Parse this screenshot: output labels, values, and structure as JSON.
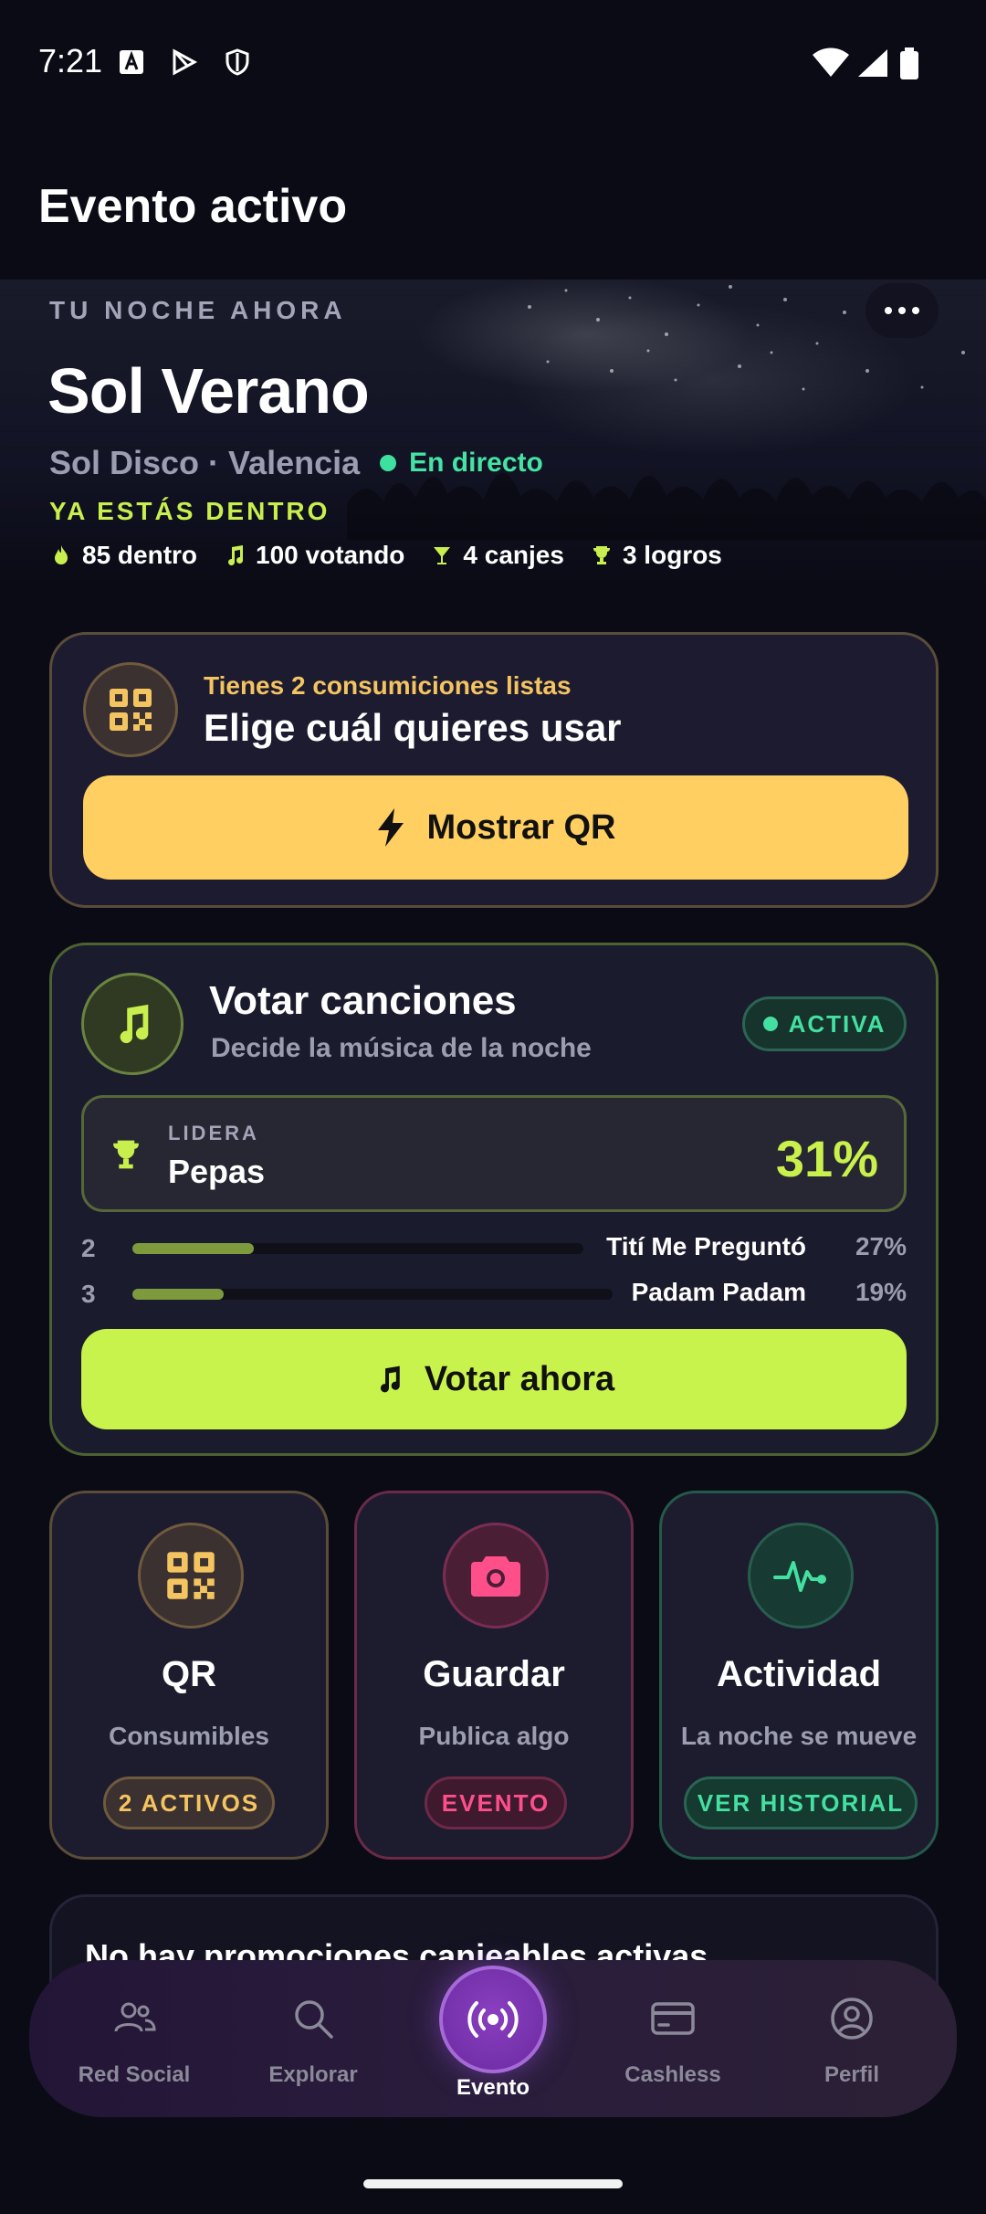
{
  "status_bar": {
    "time": "7:21"
  },
  "page": {
    "title": "Evento activo"
  },
  "hero": {
    "kicker": "TU NOCHE AHORA",
    "title": "Sol Verano",
    "venue": "Sol Disco · Valencia",
    "live": "En directo",
    "inside": "YA ESTÁS DENTRO",
    "stats": [
      {
        "icon": "flame-icon",
        "label": "85 dentro"
      },
      {
        "icon": "music-note-icon",
        "label": "100 votando"
      },
      {
        "icon": "cocktail-icon",
        "label": "4 canjes"
      },
      {
        "icon": "trophy-icon",
        "label": "3 logros"
      }
    ]
  },
  "qr_card": {
    "subtitle": "Tienes 2 consumiciones listas",
    "title": "Elige cuál quieres usar",
    "button": "Mostrar QR"
  },
  "vote_card": {
    "title": "Votar canciones",
    "subtitle": "Decide la música de la noche",
    "badge": "ACTIVA",
    "leader_kicker": "LIDERA",
    "leader_name": "Pepas",
    "leader_pct": "31%",
    "ranking": [
      {
        "rank": "2",
        "song": "Tití Me Preguntó",
        "pct": "27%",
        "fraction": 0.27
      },
      {
        "rank": "3",
        "song": "Padam Padam",
        "pct": "19%",
        "fraction": 0.19
      }
    ],
    "button": "Votar ahora"
  },
  "tiles": [
    {
      "title": "QR",
      "subtitle": "Consumibles",
      "badge": "2 ACTIVOS",
      "icon": "qr-code-icon",
      "accent": "#f4c461"
    },
    {
      "title": "Guardar",
      "subtitle": "Publica algo",
      "badge": "EVENTO",
      "icon": "camera-icon",
      "accent": "#ff4f8b"
    },
    {
      "title": "Actividad",
      "subtitle": "La noche se mueve",
      "badge": "VER HISTORIAL",
      "icon": "activity-pulse-icon",
      "accent": "#43e0a1"
    }
  ],
  "promo": {
    "text": "No hay promociones canjeables activas"
  },
  "nav": {
    "items": [
      {
        "label": "Red Social",
        "icon": "people-icon"
      },
      {
        "label": "Explorar",
        "icon": "search-icon"
      },
      {
        "label": "Evento",
        "icon": "broadcast-icon"
      },
      {
        "label": "Cashless",
        "icon": "card-icon"
      },
      {
        "label": "Perfil",
        "icon": "profile-icon"
      }
    ],
    "active": "Evento"
  }
}
